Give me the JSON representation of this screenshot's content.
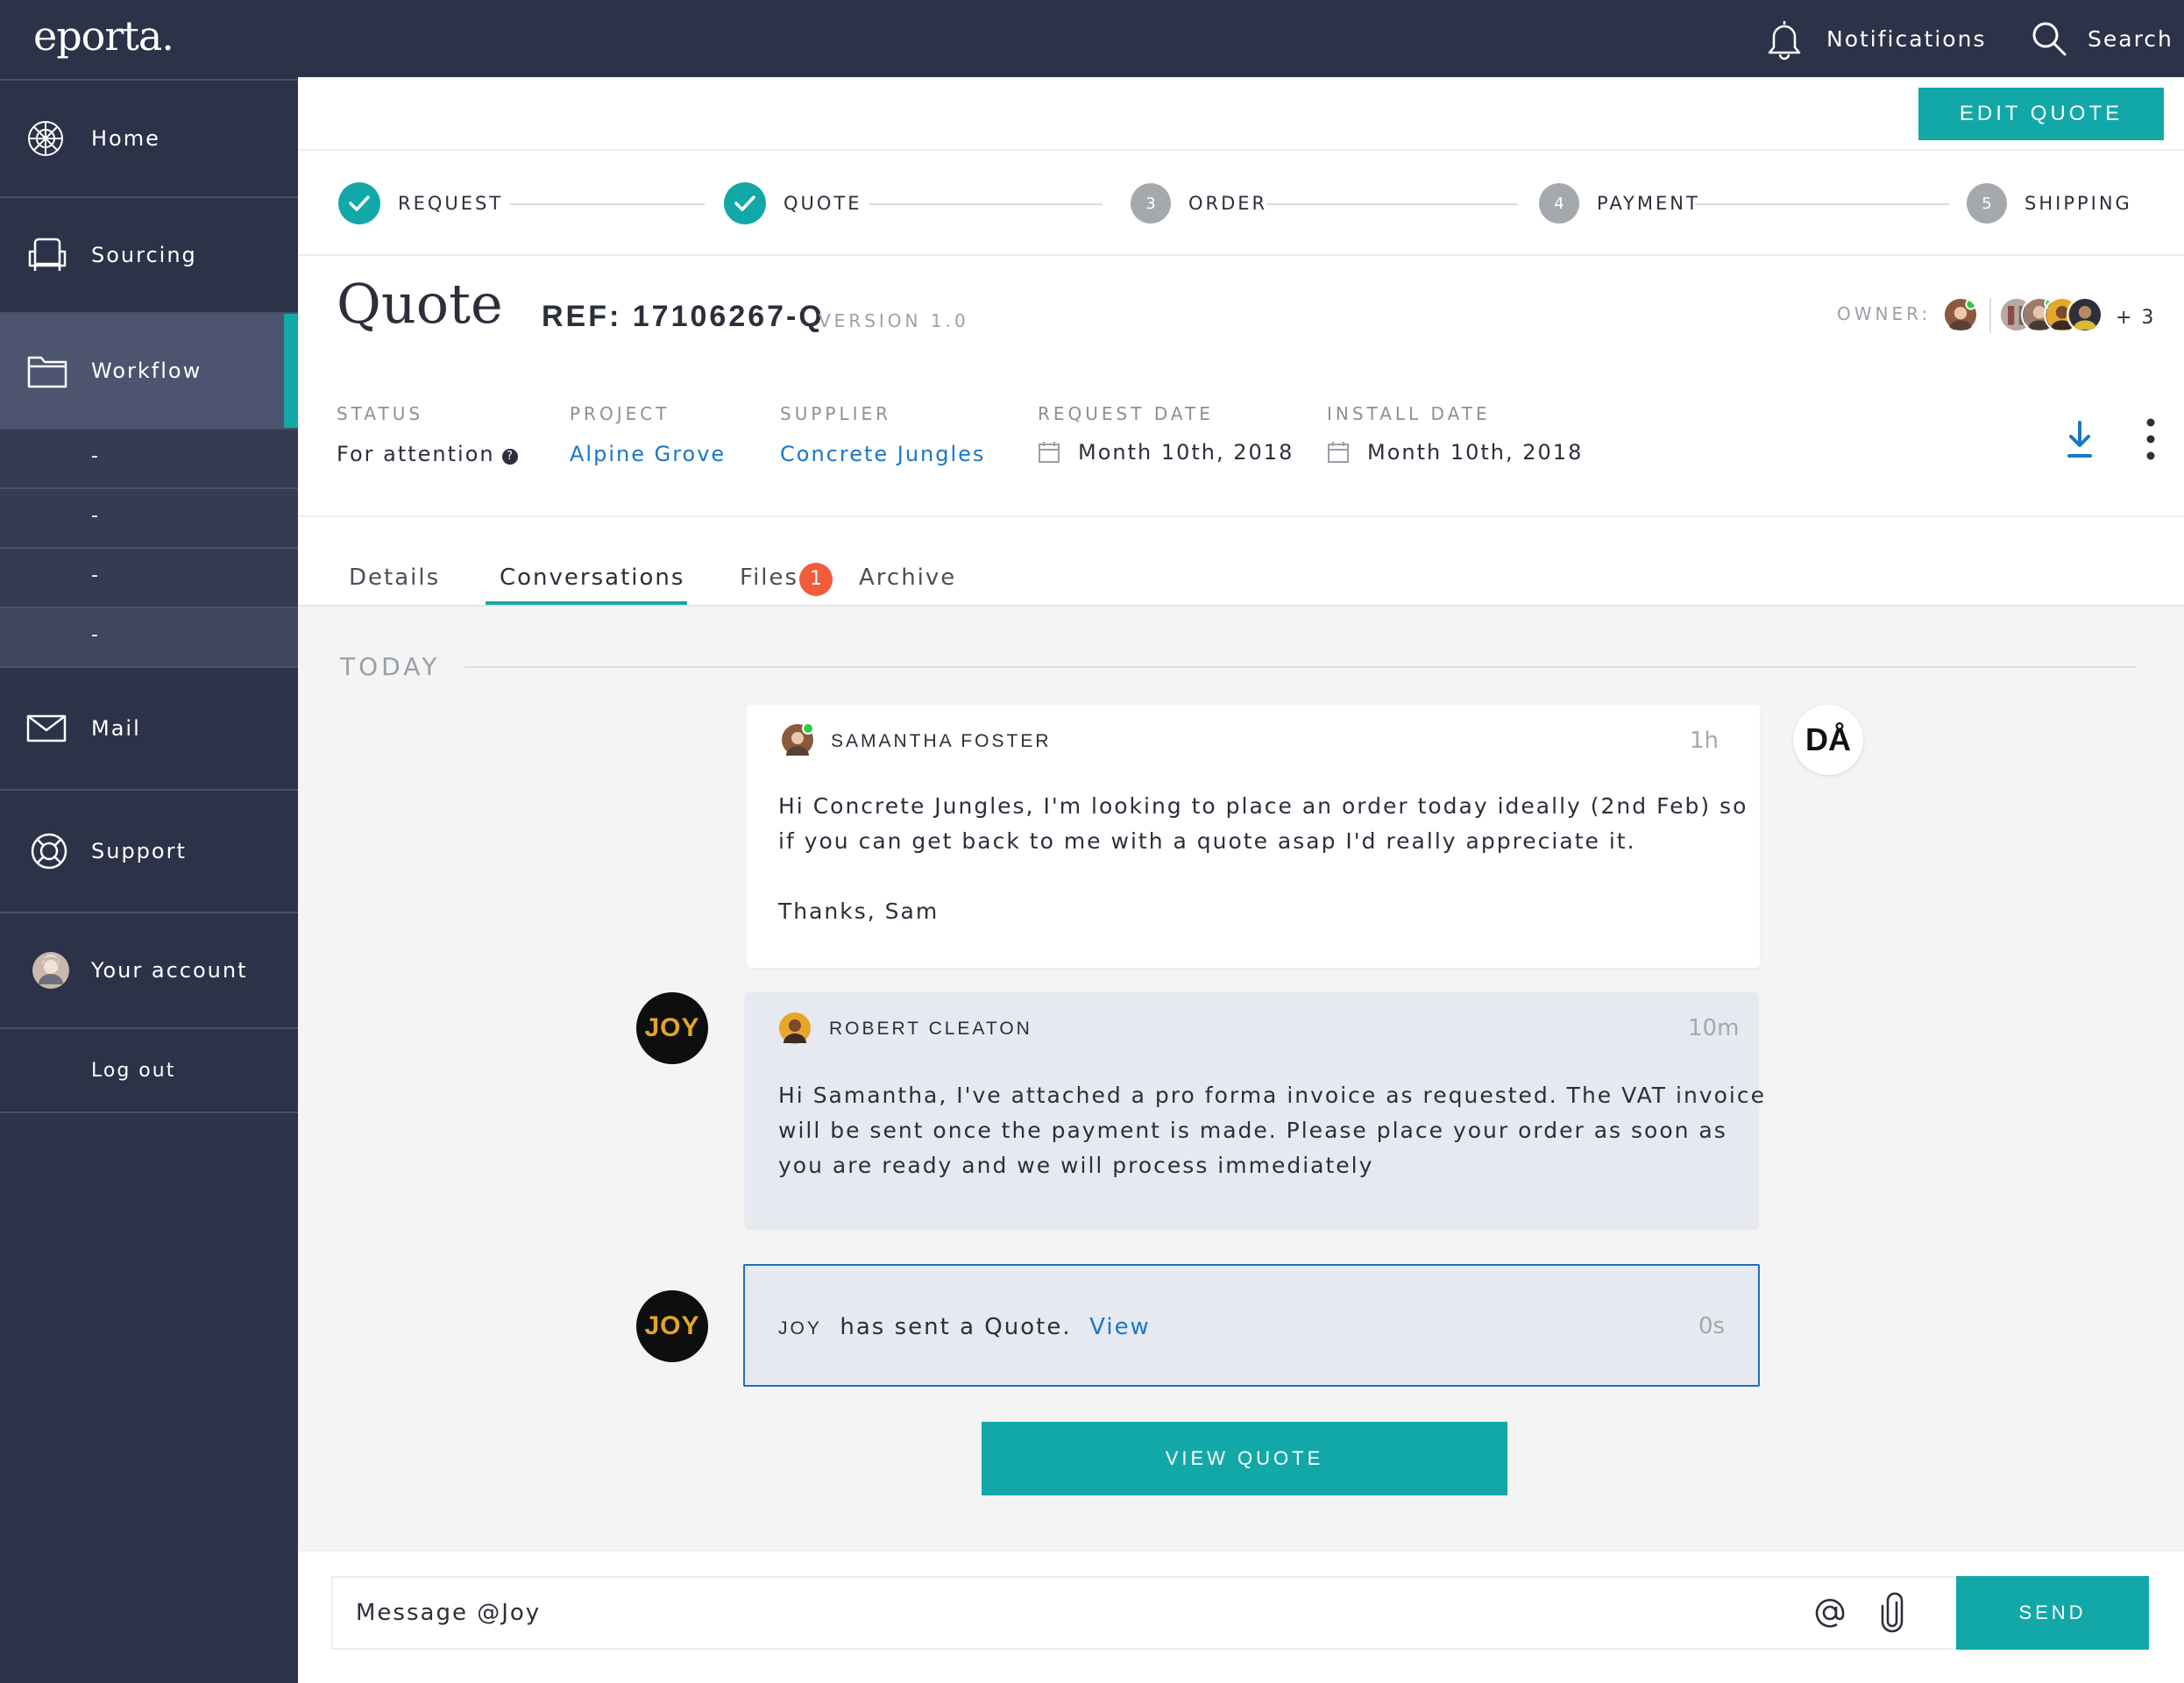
{
  "app": {
    "logo": "eporta."
  },
  "topbar": {
    "notifications": "Notifications",
    "search": "Search"
  },
  "sidebar": {
    "items": [
      {
        "label": "Home",
        "icon": "home-pattern-icon"
      },
      {
        "label": "Sourcing",
        "icon": "armchair-icon"
      },
      {
        "label": "Workflow",
        "icon": "folder-icon",
        "active": true
      },
      {
        "label": "Mail",
        "icon": "envelope-icon"
      },
      {
        "label": "Support",
        "icon": "lifebuoy-icon"
      },
      {
        "label": "Your account",
        "icon": "user-avatar"
      },
      {
        "label": "Log out"
      }
    ],
    "sub_items": [
      "-",
      "-",
      "-",
      "-"
    ]
  },
  "header": {
    "edit_button": "EDIT QUOTE",
    "steps": [
      {
        "label": "REQUEST",
        "state": "done"
      },
      {
        "label": "QUOTE",
        "state": "done"
      },
      {
        "label": "ORDER",
        "number": "3",
        "state": "todo"
      },
      {
        "label": "PAYMENT",
        "number": "4",
        "state": "todo"
      },
      {
        "label": "SHIPPING",
        "number": "5",
        "state": "todo"
      }
    ],
    "title": "Quote",
    "ref": "REF: 17106267-Q",
    "version": "VERSION 1.0",
    "owner_label": "OWNER:",
    "owner_extra": "+ 3"
  },
  "meta": {
    "status": {
      "label": "STATUS",
      "value": "For attention",
      "help": "?"
    },
    "project": {
      "label": "PROJECT",
      "value": "Alpine Grove"
    },
    "supplier": {
      "label": "SUPPLIER",
      "value": "Concrete Jungles"
    },
    "request_date": {
      "label": "REQUEST DATE",
      "value": "Month 10th, 2018"
    },
    "install_date": {
      "label": "INSTALL DATE",
      "value": "Month 10th, 2018"
    }
  },
  "tabs": [
    {
      "label": "Details"
    },
    {
      "label": "Conversations",
      "active": true
    },
    {
      "label": "Files",
      "badge": "1"
    },
    {
      "label": "Archive"
    }
  ],
  "conversation": {
    "day": "TODAY",
    "messages": [
      {
        "sender": "SAMANTHA FOSTER",
        "time": "1h",
        "line1": "Hi Concrete Jungles, I'm looking to place an order today ideally (2nd Feb) so",
        "line2": "if you can get back to me with a quote asap I'd really appreciate it.",
        "line3": "Thanks, Sam"
      },
      {
        "sender": "ROBERT CLEATON",
        "time": "10m",
        "line1": "Hi Samantha, I've attached a pro forma invoice as requested. The VAT invoice",
        "line2": "will be sent once the payment is made. Please place your order as soon as",
        "line3": "you are ready and we will process immediately"
      }
    ],
    "notice": {
      "actor": "JOY",
      "text": "has sent a Quote.",
      "link": "View",
      "time": "0s"
    },
    "avatar_joy": "JOY",
    "avatar_da": "DÅ",
    "view_quote_button": "VIEW QUOTE"
  },
  "composer": {
    "placeholder": "Message @Joy",
    "send_label": "SEND"
  },
  "colors": {
    "navy": "#2c3248",
    "teal": "#12a8a8",
    "link": "#1976c9",
    "badge": "#f25b3c"
  }
}
